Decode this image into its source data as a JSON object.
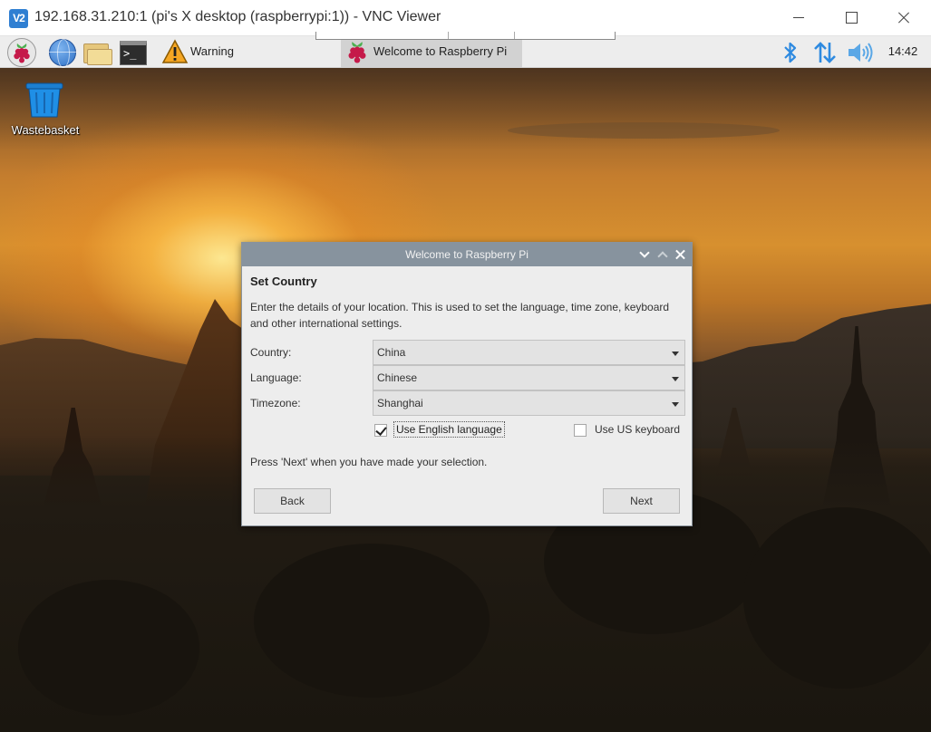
{
  "vnc": {
    "logo": "V2",
    "title": "192.168.31.210:1 (pi's X desktop (raspberrypi:1)) - VNC Viewer"
  },
  "panel": {
    "tasks": [
      {
        "label": "Warning",
        "icon": "warning-icon"
      },
      {
        "label": "Welcome to Raspberry Pi",
        "icon": "raspberry-icon"
      }
    ],
    "clock": "14:42"
  },
  "desktop": {
    "icons": [
      {
        "label": "Wastebasket",
        "icon": "wastebasket-icon"
      }
    ]
  },
  "dialog": {
    "title": "Welcome to Raspberry Pi",
    "heading": "Set Country",
    "intro": "Enter the details of your location. This is used to set the language, time zone, keyboard and other international settings.",
    "fields": {
      "country": {
        "label": "Country:",
        "value": "China"
      },
      "language": {
        "label": "Language:",
        "value": "Chinese"
      },
      "timezone": {
        "label": "Timezone:",
        "value": "Shanghai"
      }
    },
    "checkboxes": {
      "english": {
        "label": "Use English language",
        "checked": true
      },
      "us_keyboard": {
        "label": "Use US keyboard",
        "checked": false
      }
    },
    "hint": "Press 'Next' when you have made your selection.",
    "buttons": {
      "back": "Back",
      "next": "Next"
    }
  },
  "colors": {
    "dialog_titlebar": "#87939e",
    "panel_bg": "#ededed",
    "accent_blue": "#2e8ae0"
  }
}
